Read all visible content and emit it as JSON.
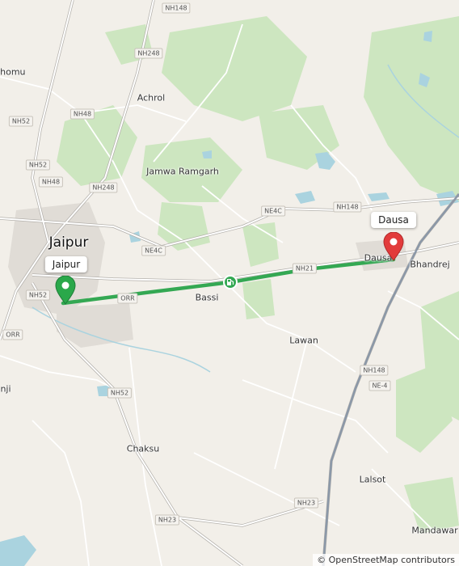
{
  "map": {
    "labels": {
      "jaipur": "Jaipur",
      "chomu": "Chomu",
      "achrol": "Achrol",
      "jamwa_ramgarh": "Jamwa Ramgarh",
      "bassi": "Bassi",
      "dausa": "Dausa",
      "bhandrej": "Bhandrej",
      "lawan": "Lawan",
      "chaksu": "Chaksu",
      "lalsot": "Lalsot",
      "mandawar": "Mandawar",
      "anji": "nji"
    },
    "roads": {
      "nh148_top": "NH148",
      "nh248_a": "NH248",
      "nh52_a": "NH52",
      "nh48_a": "NH48",
      "nh52_b": "NH52",
      "nh48_b": "NH48",
      "nh248_b": "NH248",
      "ne4c_a": "NE4C",
      "ne4c_b": "NE4C",
      "nh148_b": "NH148",
      "nh21": "NH21",
      "nh52_c": "NH52",
      "orr_a": "ORR",
      "orr_b": "ORR",
      "nh52_d": "NH52",
      "nh148_c": "NH148",
      "ne4": "NE-4",
      "nh23_a": "NH23",
      "nh23_b": "NH23"
    },
    "markers": {
      "start": {
        "label": "Jaipur",
        "color": "#2aa84a"
      },
      "end": {
        "label": "Dausa",
        "color": "#e23b3b"
      }
    },
    "route_color": "#34a853",
    "fuel_icon": "fuel-station-icon",
    "attribution": "© OpenStreetMap contributors"
  }
}
